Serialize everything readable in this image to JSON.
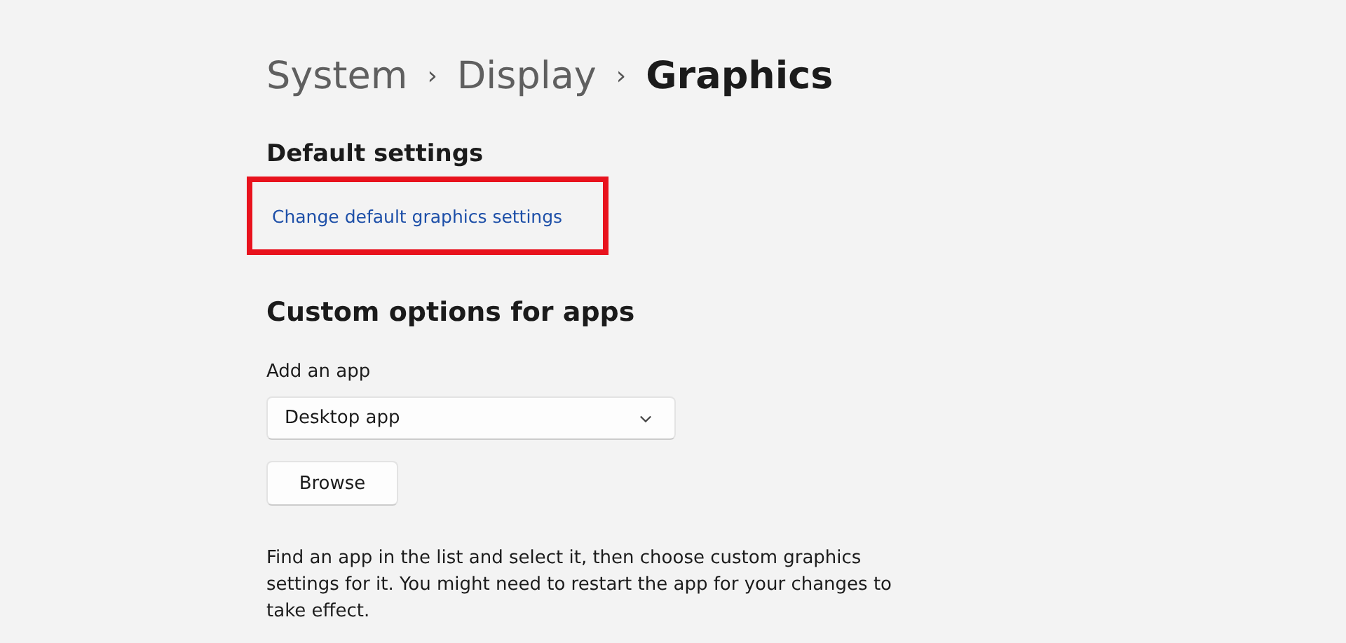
{
  "breadcrumb": [
    {
      "label": "System",
      "current": false
    },
    {
      "label": "Display",
      "current": false
    },
    {
      "label": "Graphics",
      "current": true
    }
  ],
  "separator": "›",
  "default_settings": {
    "heading": "Default settings",
    "link": {
      "label": "Change default graphics settings",
      "highlighted": true
    }
  },
  "custom_options": {
    "heading": "Custom options for apps",
    "field_label": "Add an app",
    "dropdown": {
      "value": "Desktop app"
    },
    "button": "Browse",
    "description": "Find an app in the list and select it, then choose custom graphics settings for it. You might need to restart the app for your changes to take effect."
  }
}
